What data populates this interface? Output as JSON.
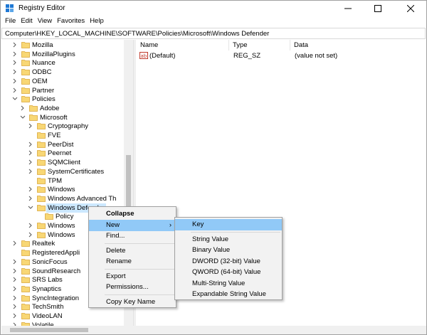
{
  "window": {
    "title": "Registry Editor"
  },
  "menu": [
    "File",
    "Edit",
    "View",
    "Favorites",
    "Help"
  ],
  "address": "Computer\\HKEY_LOCAL_MACHINE\\SOFTWARE\\Policies\\Microsoft\\Windows Defender",
  "tree": [
    {
      "label": "Mozilla",
      "level": 0,
      "expanded": false
    },
    {
      "label": "MozillaPlugins",
      "level": 0,
      "expanded": false
    },
    {
      "label": "Nuance",
      "level": 0,
      "expanded": false
    },
    {
      "label": "ODBC",
      "level": 0,
      "expanded": false
    },
    {
      "label": "OEM",
      "level": 0,
      "expanded": false
    },
    {
      "label": "Partner",
      "level": 0,
      "expanded": false
    },
    {
      "label": "Policies",
      "level": 0,
      "expanded": true
    },
    {
      "label": "Adobe",
      "level": 1,
      "expanded": false
    },
    {
      "label": "Microsoft",
      "level": 1,
      "expanded": true
    },
    {
      "label": "Cryptography",
      "level": 2,
      "expanded": false
    },
    {
      "label": "FVE",
      "level": 2,
      "expanded": null
    },
    {
      "label": "PeerDist",
      "level": 2,
      "expanded": false
    },
    {
      "label": "Peernet",
      "level": 2,
      "expanded": false
    },
    {
      "label": "SQMClient",
      "level": 2,
      "expanded": false
    },
    {
      "label": "SystemCertificates",
      "level": 2,
      "expanded": false
    },
    {
      "label": "TPM",
      "level": 2,
      "expanded": null
    },
    {
      "label": "Windows",
      "level": 2,
      "expanded": false
    },
    {
      "label": "Windows Advanced Th",
      "level": 2,
      "expanded": false
    },
    {
      "label": "Windows Defender",
      "level": 2,
      "expanded": true,
      "selected": true
    },
    {
      "label": "Policy",
      "level": 3,
      "expanded": null
    },
    {
      "label": "Windows",
      "level": 2,
      "expanded": false
    },
    {
      "label": "Windows",
      "level": 2,
      "expanded": false
    },
    {
      "label": "Realtek",
      "level": 0,
      "expanded": false
    },
    {
      "label": "RegisteredAppli",
      "level": 0,
      "expanded": null
    },
    {
      "label": "SonicFocus",
      "level": 0,
      "expanded": false
    },
    {
      "label": "SoundResearch",
      "level": 0,
      "expanded": false
    },
    {
      "label": "SRS Labs",
      "level": 0,
      "expanded": false
    },
    {
      "label": "Synaptics",
      "level": 0,
      "expanded": false
    },
    {
      "label": "SyncIntegration",
      "level": 0,
      "expanded": false
    },
    {
      "label": "TechSmith",
      "level": 0,
      "expanded": false
    },
    {
      "label": "VideoLAN",
      "level": 0,
      "expanded": false
    },
    {
      "label": "Volatile",
      "level": 0,
      "expanded": false
    }
  ],
  "columns": [
    "Name",
    "Type",
    "Data"
  ],
  "values": [
    {
      "name": "(Default)",
      "type": "REG_SZ",
      "data": "(value not set)"
    }
  ],
  "context_menu": [
    {
      "label": "Collapse",
      "bold": true
    },
    {
      "label": "New",
      "submenu": true,
      "highlight": true
    },
    {
      "label": "Find..."
    },
    {
      "sep": true
    },
    {
      "label": "Delete"
    },
    {
      "label": "Rename"
    },
    {
      "sep": true
    },
    {
      "label": "Export"
    },
    {
      "label": "Permissions..."
    },
    {
      "sep": true
    },
    {
      "label": "Copy Key Name"
    }
  ],
  "submenu": [
    {
      "label": "Key",
      "highlight": true
    },
    {
      "sep": true
    },
    {
      "label": "String Value"
    },
    {
      "label": "Binary Value"
    },
    {
      "label": "DWORD (32-bit) Value"
    },
    {
      "label": "QWORD (64-bit) Value"
    },
    {
      "label": "Multi-String Value"
    },
    {
      "label": "Expandable String Value"
    }
  ],
  "colors": {
    "selection": "#cce8ff",
    "menu_highlight": "#91c9f7",
    "folder": "#f8d775"
  }
}
